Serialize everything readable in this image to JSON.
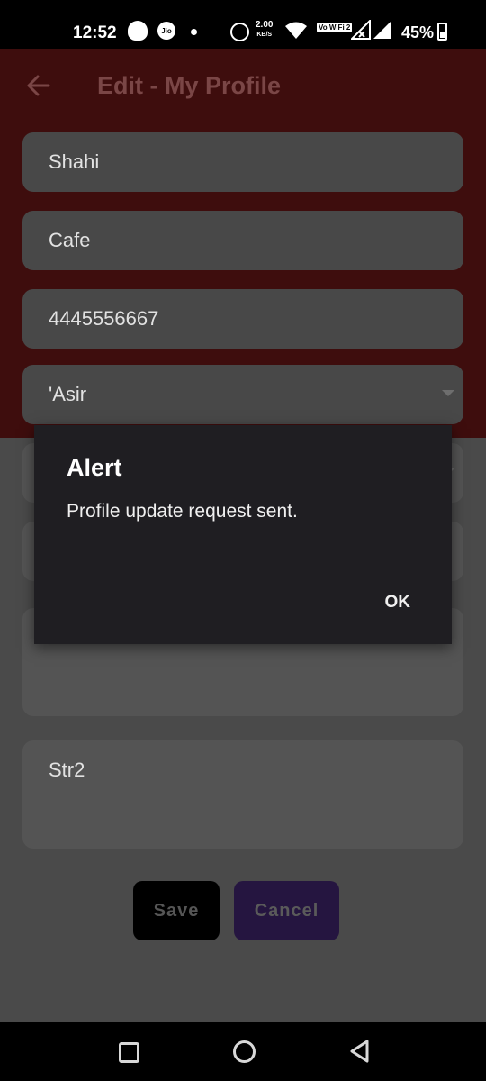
{
  "status_bar": {
    "time": "12:52",
    "network_speed": "2.00",
    "network_speed_unit": "KB/S",
    "vowifi_label": "Vo WiFi 2",
    "battery_percent": "45%",
    "battery_level": 0.45,
    "icons": [
      "snapchat-icon",
      "jio-icon",
      "notification-dot-icon",
      "alarm-icon",
      "wifi-icon",
      "vowifi-icon",
      "signal-icon",
      "signal-icon",
      "battery-icon"
    ]
  },
  "app_bar": {
    "title": "Edit - My Profile",
    "back_icon": "arrow-left-icon"
  },
  "form": {
    "first_name": "Shahi",
    "last_name": "Cafe",
    "phone": "4445556667",
    "region": "'Asir",
    "address": "Str2"
  },
  "buttons": {
    "save": "Save",
    "cancel": "Cancel"
  },
  "dialog": {
    "title": "Alert",
    "message": "Profile update request sent.",
    "ok": "OK"
  },
  "colors": {
    "app_bar_dimmed": "#3e0d0d",
    "dialog_bg": "#1f1e22",
    "cancel_button": "#251540"
  }
}
